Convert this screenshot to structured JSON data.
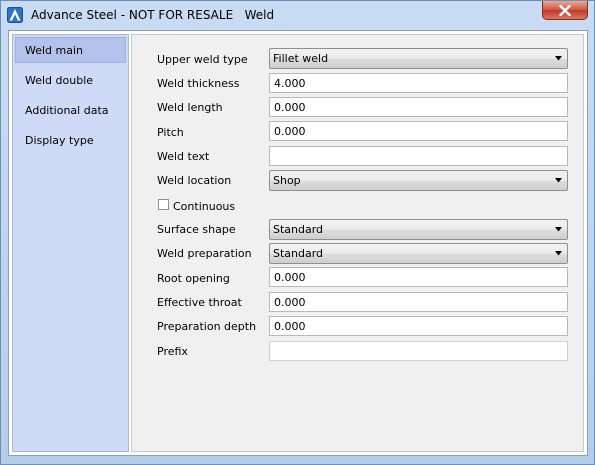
{
  "window": {
    "title": "Advance Steel - NOT FOR RESALE   Weld",
    "app_icon": "advance-steel-icon",
    "close_icon": "close-icon"
  },
  "sidebar": {
    "items": [
      {
        "label": "Weld main",
        "active": true
      },
      {
        "label": "Weld double",
        "active": false
      },
      {
        "label": "Additional data",
        "active": false
      },
      {
        "label": "Display type",
        "active": false
      }
    ]
  },
  "form": {
    "upper_weld_type": {
      "label": "Upper weld type",
      "value": "Fillet weld"
    },
    "weld_thickness": {
      "label": "Weld thickness",
      "value": "4.000"
    },
    "weld_length": {
      "label": "Weld length",
      "value": "0.000"
    },
    "pitch": {
      "label": "Pitch",
      "value": "0.000"
    },
    "weld_text": {
      "label": "Weld text",
      "value": ""
    },
    "weld_location": {
      "label": "Weld location",
      "value": "Shop"
    },
    "continuous": {
      "label": "Continuous",
      "checked": false
    },
    "surface_shape": {
      "label": "Surface shape",
      "value": "Standard"
    },
    "weld_preparation": {
      "label": "Weld preparation",
      "value": "Standard"
    },
    "root_opening": {
      "label": "Root opening",
      "value": "0.000"
    },
    "effective_throat": {
      "label": "Effective throat",
      "value": "0.000"
    },
    "preparation_depth": {
      "label": "Preparation depth",
      "value": "0.000"
    },
    "prefix": {
      "label": "Prefix",
      "value": ""
    }
  },
  "colors": {
    "titlebar": "#c9dcf3",
    "sidebar": "#cfdaf7",
    "sidebar_active": "#b2c2ea",
    "panel": "#f0f0f0",
    "close_button": "#c0392b"
  }
}
